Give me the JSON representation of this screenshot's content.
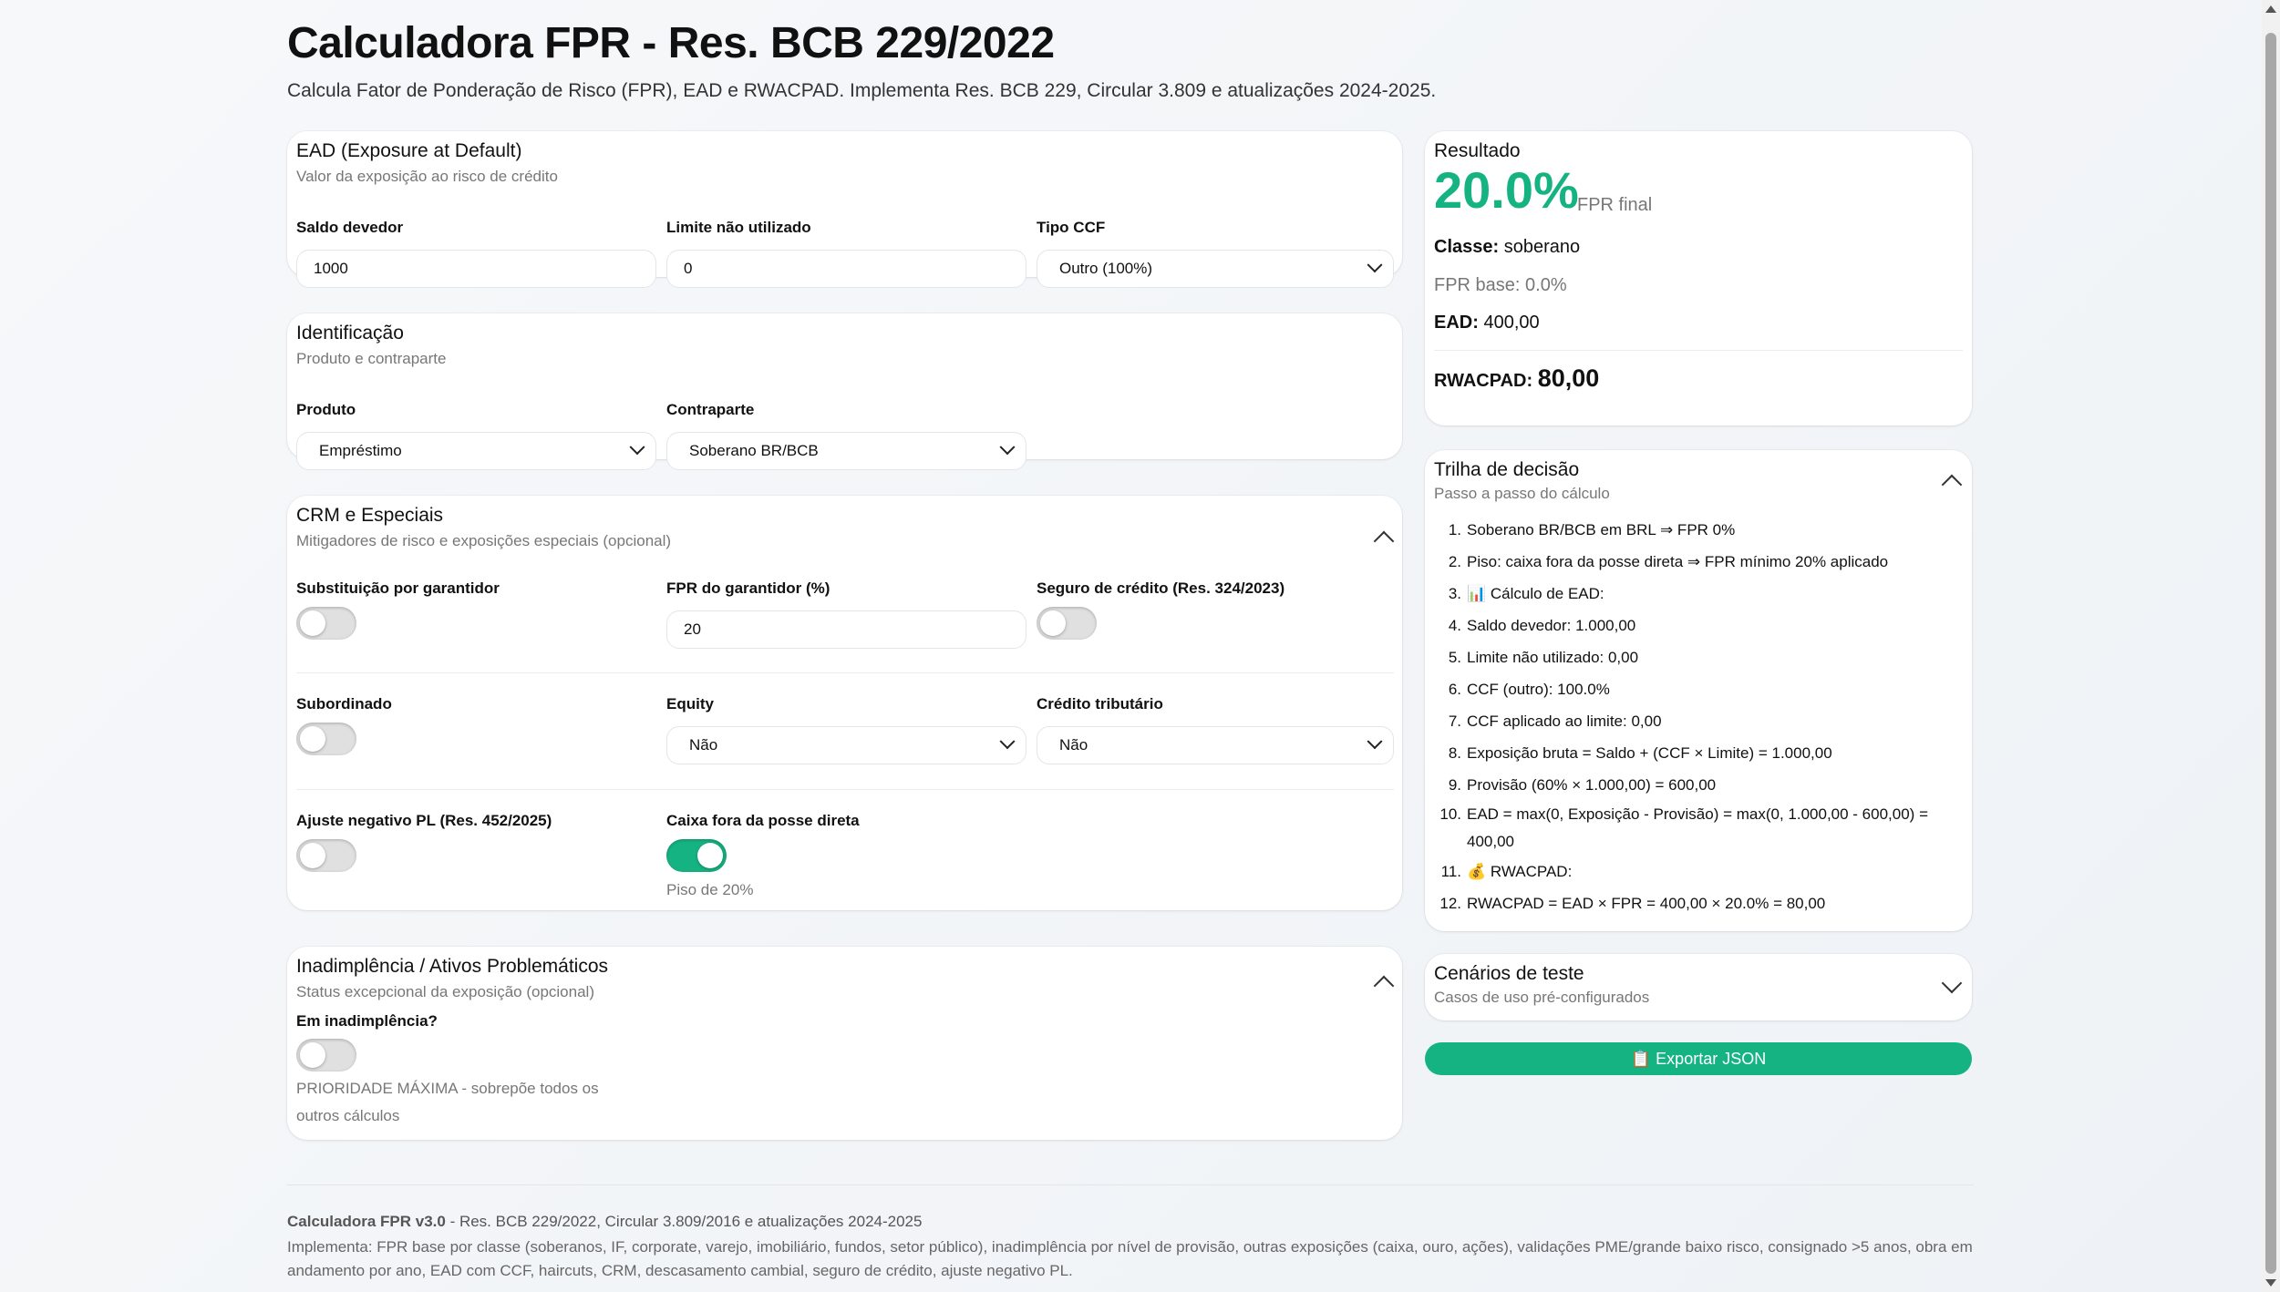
{
  "header": {
    "title": "Calculadora FPR - Res. BCB 229/2022",
    "subtitle": "Calcula Fator de Ponderação de Risco (FPR), EAD e RWACPAD. Implementa Res. BCB 229, Circular 3.809 e atualizações 2024-2025."
  },
  "ead": {
    "title": "EAD (Exposure at Default)",
    "subtitle": "Valor da exposição ao risco de crédito",
    "saldo_label": "Saldo devedor",
    "saldo_value": "1000",
    "limite_label": "Limite não utilizado",
    "limite_value": "0",
    "ccf_label": "Tipo CCF",
    "ccf_value": "Outro (100%)"
  },
  "identificacao": {
    "title": "Identificação",
    "subtitle": "Produto e contraparte",
    "produto_label": "Produto",
    "produto_value": "Empréstimo",
    "contraparte_label": "Contraparte",
    "contraparte_value": "Soberano BR/BCB"
  },
  "crm": {
    "title": "CRM e Especiais",
    "subtitle": "Mitigadores de risco e exposições especiais (opcional)",
    "substituicao_label": "Substituição por garantidor",
    "substituicao_on": false,
    "fpr_garantidor_label": "FPR do garantidor (%)",
    "fpr_garantidor_value": "20",
    "seguro_label": "Seguro de crédito (Res. 324/2023)",
    "seguro_on": false,
    "subordinado_label": "Subordinado",
    "subordinado_on": false,
    "equity_label": "Equity",
    "equity_value": "Não",
    "credito_label": "Crédito tributário",
    "credito_value": "Não",
    "ajuste_label": "Ajuste negativo PL (Res. 452/2025)",
    "ajuste_on": false,
    "caixa_label": "Caixa fora da posse direta",
    "caixa_on": true,
    "caixa_hint": "Piso de 20%"
  },
  "inadimplencia": {
    "title": "Inadimplência / Ativos Problemáticos",
    "subtitle": "Status excepcional da exposição (opcional)",
    "em_label": "Em inadimplência?",
    "em_on": false,
    "hint_line1": "PRIORIDADE MÁXIMA - sobrepõe todos os",
    "hint_line2": "outros cálculos"
  },
  "resultado": {
    "title": "Resultado",
    "fpr_value": "20.0%",
    "fpr_caption": "FPR final",
    "classe_label": "Classe:",
    "classe_value": "soberano",
    "fpr_base": "FPR base: 0.0%",
    "ead_label": "EAD:",
    "ead_value": "400,00",
    "rwacpad_label": "RWACPAD:",
    "rwacpad_value": "80,00"
  },
  "trilha": {
    "title": "Trilha de decisão",
    "subtitle": "Passo a passo do cálculo",
    "steps": [
      {
        "n": "1.",
        "t": "Soberano BR/BCB em BRL ⇒ FPR 0%"
      },
      {
        "n": "2.",
        "t": "Piso: caixa fora da posse direta ⇒ FPR mínimo 20% aplicado"
      },
      {
        "n": "3.",
        "t": "📊 Cálculo de EAD:"
      },
      {
        "n": "4.",
        "t": "Saldo devedor: 1.000,00"
      },
      {
        "n": "5.",
        "t": "Limite não utilizado: 0,00"
      },
      {
        "n": "6.",
        "t": "CCF (outro): 100.0%"
      },
      {
        "n": "7.",
        "t": "CCF aplicado ao limite: 0,00"
      },
      {
        "n": "8.",
        "t": "Exposição bruta = Saldo + (CCF × Limite) = 1.000,00"
      },
      {
        "n": "9.",
        "t": "Provisão (60% × 1.000,00) = 600,00"
      },
      {
        "n": "10.",
        "t": "EAD = max(0, Exposição - Provisão) = max(0, 1.000,00 - 600,00) = 400,00"
      },
      {
        "n": "11.",
        "t": "💰 RWACPAD:"
      },
      {
        "n": "12.",
        "t": "RWACPAD = EAD × FPR = 400,00 × 20.0% = 80,00"
      }
    ]
  },
  "cenarios": {
    "title": "Cenários de teste",
    "subtitle": "Casos de uso pré-configurados"
  },
  "export_label": "📋 Exportar JSON",
  "footer": {
    "version": "Calculadora FPR v3.0",
    "version_rest": " - Res. BCB 229/2022, Circular 3.809/2016 e atualizações 2024-2025",
    "implements": "Implementa: FPR base por classe (soberanos, IF, corporate, varejo, imobiliário, fundos, setor público), inadimplência por nível de provisão, outras exposições (caixa, ouro, ações), validações PME/grande baixo risco, consignado >5 anos, obra em andamento por ano, EAD com CCF, haircuts, CRM, descasamento cambial, seguro de crédito, ajuste negativo PL."
  }
}
